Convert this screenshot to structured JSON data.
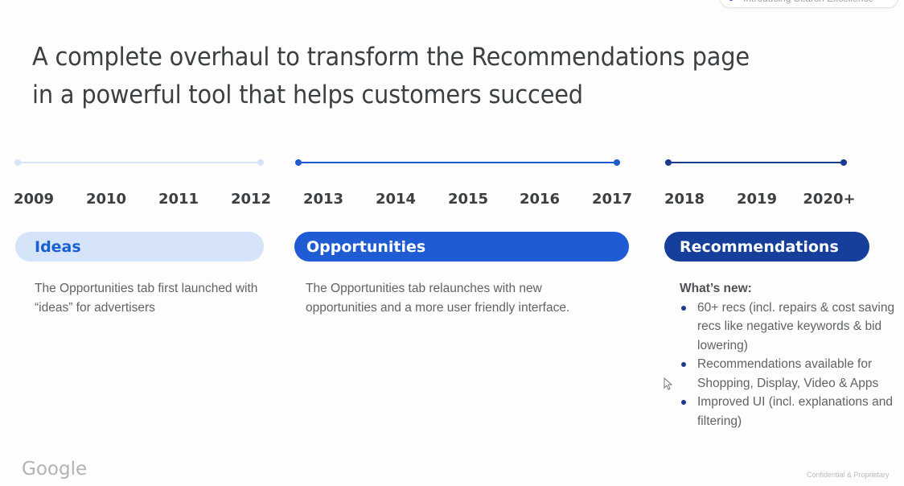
{
  "header_chip": {
    "label": "Introducing Search Excellence",
    "dot_color": "#1a49c4"
  },
  "title": {
    "line1": "A complete overhaul to transform the Recommendations page",
    "line2": "in a powerful tool that helps customers succeed"
  },
  "timeline": {
    "phases": [
      {
        "name": "Ideas",
        "years": [
          "2009",
          "2010",
          "2011",
          "2012"
        ],
        "track_color": "#d6e4f9",
        "pill_bg": "#d6e4fa",
        "pill_text_color": "#1a5fd0",
        "description": "The Opportunities tab first launched with “ideas” for advertisers"
      },
      {
        "name": "Opportunities",
        "years": [
          "2013",
          "2014",
          "2015",
          "2016",
          "2017"
        ],
        "track_color": "#1c5bd1",
        "pill_bg": "#1f5bd3",
        "pill_text_color": "#ffffff",
        "description": "The Opportunities tab relaunches with new opportunities and a more user friendly interface."
      },
      {
        "name": "Recommendations",
        "years": [
          "2018",
          "2019",
          "2020+"
        ],
        "track_color": "#1a3a8f",
        "pill_bg": "#153f9a",
        "pill_text_color": "#ffffff",
        "whats_new_label": "What’s new:",
        "bullets": [
          "60+ recs (incl. repairs & cost saving recs like negative keywords & bid lowering)",
          "Recommendations available for Shopping, Display, Video & Apps",
          "Improved UI (incl. explanations and filtering)"
        ]
      }
    ]
  },
  "footer": {
    "logo": "Google",
    "confidential": "Confidential & Proprietary"
  }
}
